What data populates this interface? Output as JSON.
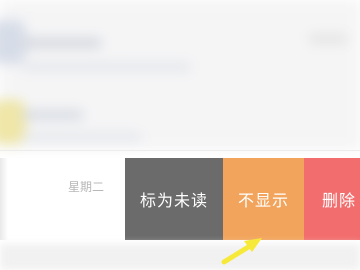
{
  "swipe_row": {
    "date": "星期二",
    "actions": {
      "mark_unread": "标为未读",
      "hide": "不显示",
      "delete": "删除"
    }
  },
  "colors": {
    "mark_unread_bg": "#6b6b6b",
    "hide_bg": "#f3a45c",
    "delete_bg": "#f26d6d",
    "annotation_arrow": "#f7e93a"
  },
  "icons": {
    "annotation": "arrow-up-right-icon"
  }
}
